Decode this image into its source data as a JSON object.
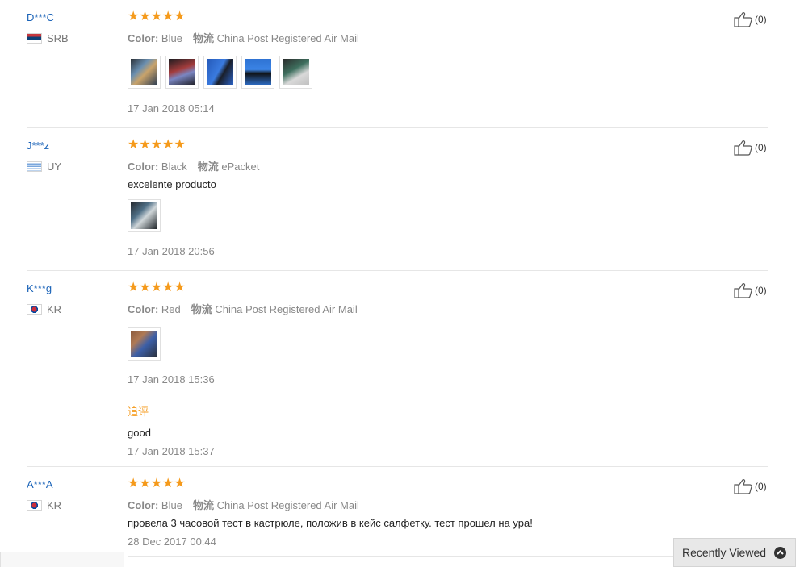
{
  "reviews": [
    {
      "user": "D***C",
      "country": "SRB",
      "stars": "★★★★★",
      "color_label": "Color:",
      "color_value": "Blue",
      "shipping_label": "物流",
      "shipping_value": "China Post Registered Air Mail",
      "text": "",
      "date": "17 Jan 2018 05:14",
      "helpful": "(0)"
    },
    {
      "user": "J***z",
      "country": "UY",
      "stars": "★★★★★",
      "color_label": "Color:",
      "color_value": "Black",
      "shipping_label": "物流",
      "shipping_value": "ePacket",
      "text": "excelente producto",
      "date": "17 Jan 2018 20:56",
      "helpful": "(0)"
    },
    {
      "user": "K***g",
      "country": "KR",
      "stars": "★★★★★",
      "color_label": "Color:",
      "color_value": "Red",
      "shipping_label": "物流",
      "shipping_value": "China Post Registered Air Mail",
      "text": "",
      "date": "17 Jan 2018 15:36",
      "helpful": "(0)",
      "followup": {
        "label": "追评",
        "text": "good",
        "date": "17 Jan 2018 15:37"
      }
    },
    {
      "user": "A***A",
      "country": "KR",
      "stars": "★★★★★",
      "color_label": "Color:",
      "color_value": "Blue",
      "shipping_label": "物流",
      "shipping_value": "China Post Registered Air Mail",
      "text": "провела 3 часовой тест в кастрюле, положив в кейс салфетку. тест прошел на ура!",
      "date": "28 Dec 2017 00:44",
      "helpful": "(0)"
    }
  ],
  "recently_viewed": "Recently Viewed",
  "colors": {
    "star": "#f59a1b",
    "link": "#1a63b8",
    "followup": "#f59a1b"
  },
  "icons": {
    "helpful": "thumbs-up-icon",
    "recently_viewed": "chevron-up-circle-icon"
  }
}
